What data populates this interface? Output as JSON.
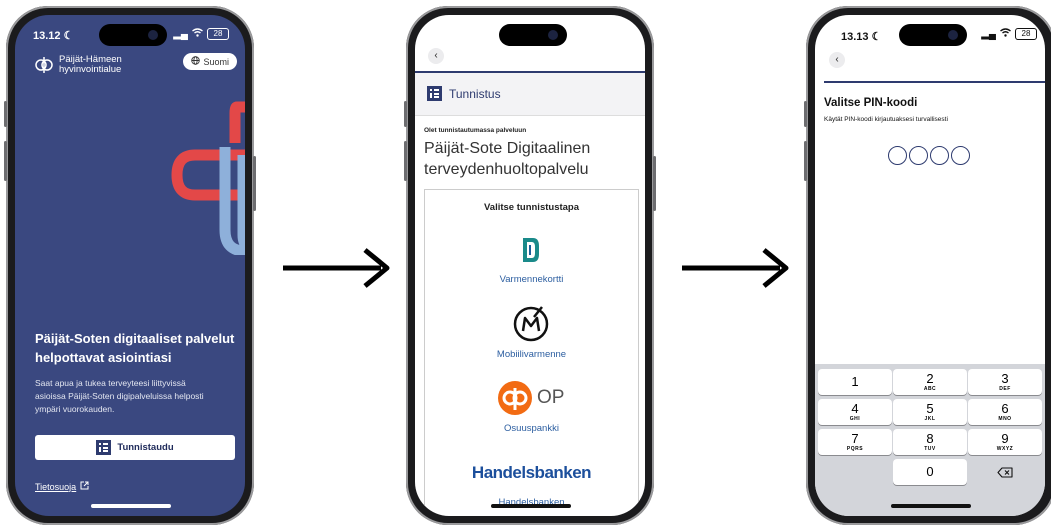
{
  "phone1": {
    "status_time": "13.12",
    "battery": "28",
    "logo_line1": "Päijät-Hämeen",
    "logo_line2": "hyvinvointialue",
    "language_button": "Suomi",
    "headline_line1": "Päijät-Soten digitaaliset palvelut",
    "headline_line2": "helpottavat asiointiasi",
    "body_line1": "Saat apua ja tukea terveyteesi liittyvissä",
    "body_line2": "asioissa Päijät-Soten digipalveluissa helposti",
    "body_line3": "ympäri vuorokauden.",
    "cta_label": "Tunnistaudu",
    "privacy_link": "Tietosuoja"
  },
  "phone2": {
    "header_title": "Tunnistus",
    "service_intro": "Olet tunnistautumassa palveluun",
    "service_name_line1": "Päijät-Sote Digitaalinen",
    "service_name_line2": "terveydenhuoltopalvelu",
    "choose_method": "Valitse tunnistustapa",
    "providers": [
      {
        "label": "Varmennekortti",
        "icon": "card-certificate-icon"
      },
      {
        "label": "Mobiilivarmenne",
        "icon": "mobile-certificate-icon"
      },
      {
        "label": "Osuuspankki",
        "icon": "op-bank-logo",
        "logo_text": "OP"
      },
      {
        "label": "Handelsbanken",
        "icon": "handelsbanken-logo",
        "logo_text": "Handelsbanken"
      }
    ]
  },
  "phone3": {
    "status_time": "13.13",
    "battery": "28",
    "title": "Valitse PIN-koodi",
    "subtitle": "Käytät PIN-koodi kirjautuaksesi turvallisesti",
    "pin_length": 4,
    "keys": [
      {
        "n": "1",
        "l": ""
      },
      {
        "n": "2",
        "l": "ABC"
      },
      {
        "n": "3",
        "l": "DEF"
      },
      {
        "n": "4",
        "l": "GHI"
      },
      {
        "n": "5",
        "l": "JKL"
      },
      {
        "n": "6",
        "l": "MNO"
      },
      {
        "n": "7",
        "l": "PQRS"
      },
      {
        "n": "8",
        "l": "TUV"
      },
      {
        "n": "9",
        "l": "WXYZ"
      },
      {
        "n": "0",
        "l": ""
      }
    ]
  },
  "colors": {
    "brand_navy": "#3a4880",
    "accent_red": "#e34848",
    "accent_lightblue": "#8eb0da",
    "op_orange": "#f26b13",
    "link_blue": "#2c5ea0"
  }
}
